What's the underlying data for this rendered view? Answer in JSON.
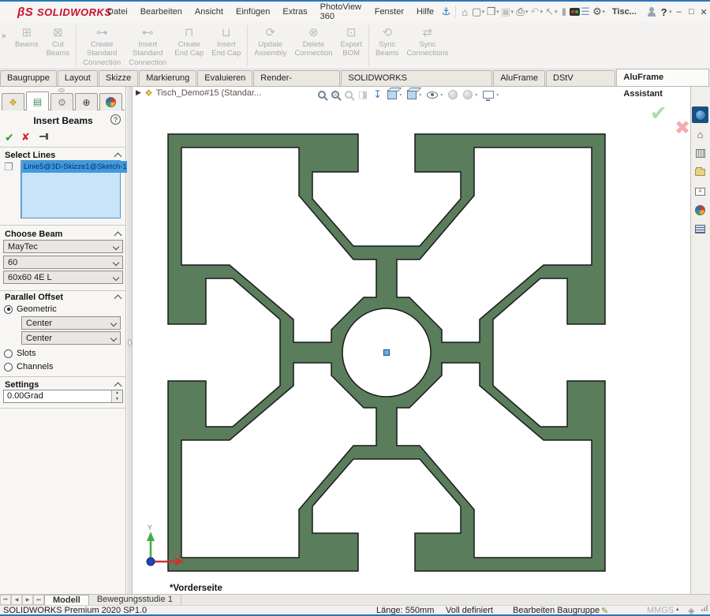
{
  "titlebar": {
    "logo_text": "SOLIDWORKS",
    "menus": [
      "Datei",
      "Bearbeiten",
      "Ansicht",
      "Einfügen",
      "Extras",
      "PhotoView 360",
      "Fenster",
      "Hilfe"
    ],
    "doc_short": "Tisc...",
    "help_label": "?"
  },
  "ribbon": {
    "buttons": [
      {
        "label": "Beams"
      },
      {
        "label": "Cut\nBeams"
      },
      {
        "label": "Create\nStandard\nConnection"
      },
      {
        "label": "Insert\nStandard\nConnection"
      },
      {
        "label": "Create\nEnd Cap"
      },
      {
        "label": "Insert\nEnd Cap"
      },
      {
        "label": "Update\nAssembly"
      },
      {
        "label": "Delete\nConnection"
      },
      {
        "label": "Export\nBOM"
      },
      {
        "label": "Sync\nBeams"
      },
      {
        "label": "Sync\nConnections"
      }
    ]
  },
  "command_tabs": {
    "items": [
      "Baugruppe",
      "Layout",
      "Skizze",
      "Markierung",
      "Evaluieren",
      "Render-Werkzeuge",
      "SOLIDWORKS Zusatzanwendungen",
      "AluFrame",
      "DStV Assistant",
      "AluFrame Assistant"
    ],
    "active": "AluFrame Assistant"
  },
  "panel": {
    "title": "Insert Beams",
    "select_lines": {
      "header": "Select Lines",
      "selected_item": "Linie5@3D-Skizze1@Sketch-1"
    },
    "choose_beam": {
      "header": "Choose Beam",
      "vendor": "MayTec",
      "series": "60",
      "profile": "60x60 4E L"
    },
    "parallel_offset": {
      "header": "Parallel Offset",
      "option_geometric": "Geometric",
      "option_slots": "Slots",
      "option_channels": "Channels",
      "offset1": "Center",
      "offset2": "Center"
    },
    "settings": {
      "header": "Settings",
      "angle": "0.00Grad"
    }
  },
  "viewport": {
    "doc_title": "Tisch_Demo#15  (Standar...",
    "view_name": "*Vorderseite",
    "triad_x": "x",
    "triad_y": "Y"
  },
  "model_tabs": {
    "items": [
      "Modell",
      "Bewegungsstudie 1"
    ],
    "active": "Modell"
  },
  "status_bar": {
    "product": "SOLIDWORKS Premium 2020 SP1.0",
    "length": "Länge: 550mm",
    "constraint": "Voll definiert",
    "mode": "Bearbeiten Baugruppe",
    "units": "MMGS"
  },
  "colors": {
    "accent_blue": "#2878be",
    "profile_green": "#5a7d5c",
    "selection_blue": "#3f9ae0"
  }
}
